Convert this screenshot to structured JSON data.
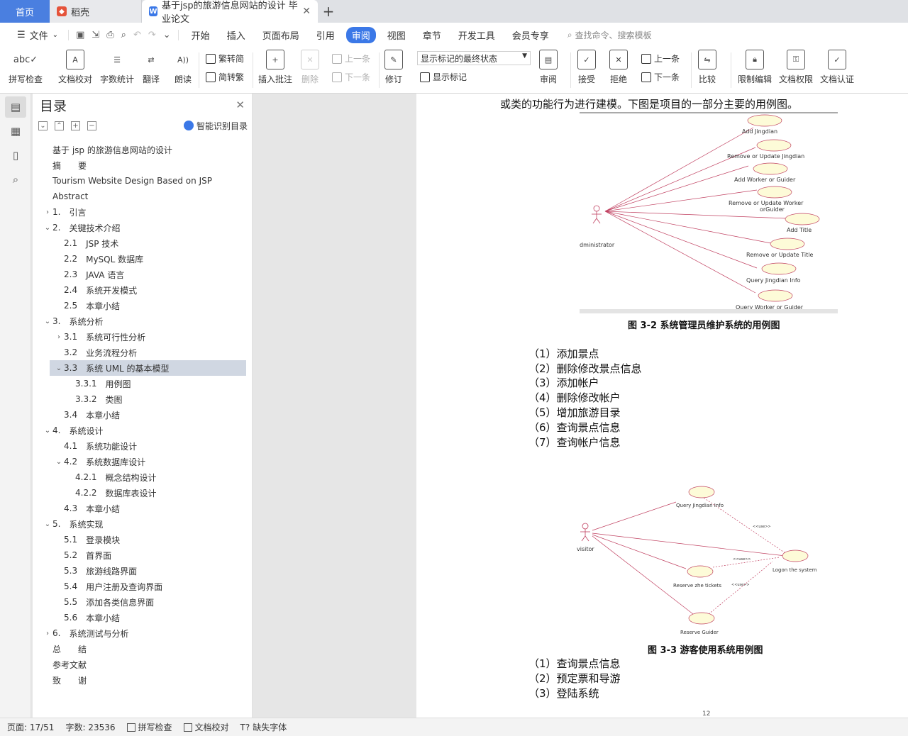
{
  "tabs": {
    "home": "首页",
    "docer": "稻壳",
    "active": "基于jsp的旅游信息网站的设计 毕业论文"
  },
  "menu": {
    "file": "文件",
    "items": [
      "开始",
      "插入",
      "页面布局",
      "引用",
      "审阅",
      "视图",
      "章节",
      "开发工具",
      "会员专享"
    ],
    "search": "查找命令、搜索模板"
  },
  "ribbon": {
    "spell": "拼写检查",
    "proof": "文档校对",
    "wordcount": "字数统计",
    "translate": "翻译",
    "read": "朗读",
    "trad": "繁转简",
    "simp": "简转繁",
    "insert_comment": "插入批注",
    "delete": "删除",
    "prev": "上一条",
    "next": "下一条",
    "revise": "修订",
    "display_state": "显示标记的最终状态",
    "show_marks": "显示标记",
    "review": "审阅",
    "accept": "接受",
    "reject": "拒绝",
    "prev2": "上一条",
    "next2": "下一条",
    "compare": "比较",
    "restrict": "限制编辑",
    "perm": "文档权限",
    "cert": "文档认证"
  },
  "toc": {
    "title": "目录",
    "smart": "智能识别目录",
    "items": [
      {
        "num": "",
        "text": "基于 jsp 的旅游信息网站的设计",
        "level": 0,
        "arrow": ""
      },
      {
        "num": "",
        "text": "摘　　要",
        "level": 0,
        "arrow": ""
      },
      {
        "num": "",
        "text": "Tourism Website Design Based on JSP",
        "level": 0,
        "arrow": ""
      },
      {
        "num": "",
        "text": "Abstract",
        "level": 0,
        "arrow": ""
      },
      {
        "num": "1.",
        "text": "引言",
        "level": 0,
        "arrow": "›"
      },
      {
        "num": "2.",
        "text": "关键技术介绍",
        "level": 0,
        "arrow": "⌄"
      },
      {
        "num": "2.1",
        "text": "JSP 技术",
        "level": 1,
        "arrow": ""
      },
      {
        "num": "2.2",
        "text": "MySQL 数据库",
        "level": 1,
        "arrow": ""
      },
      {
        "num": "2.3",
        "text": "JAVA 语言",
        "level": 1,
        "arrow": ""
      },
      {
        "num": "2.4",
        "text": "系统开发模式",
        "level": 1,
        "arrow": ""
      },
      {
        "num": "2.5",
        "text": "本章小结",
        "level": 1,
        "arrow": ""
      },
      {
        "num": "3.",
        "text": "系统分析",
        "level": 0,
        "arrow": "⌄"
      },
      {
        "num": "3.1",
        "text": "系统可行性分析",
        "level": 1,
        "arrow": "›"
      },
      {
        "num": "3.2",
        "text": "业务流程分析",
        "level": 1,
        "arrow": ""
      },
      {
        "num": "3.3",
        "text": "系统 UML 的基本模型",
        "level": 1,
        "arrow": "⌄",
        "selected": true
      },
      {
        "num": "3.3.1",
        "text": "用例图",
        "level": 2,
        "arrow": ""
      },
      {
        "num": "3.3.2",
        "text": "类图",
        "level": 2,
        "arrow": ""
      },
      {
        "num": "3.4",
        "text": "本章小结",
        "level": 1,
        "arrow": ""
      },
      {
        "num": "4.",
        "text": "系统设计",
        "level": 0,
        "arrow": "⌄"
      },
      {
        "num": "4.1",
        "text": "系统功能设计",
        "level": 1,
        "arrow": ""
      },
      {
        "num": "4.2",
        "text": "系统数据库设计",
        "level": 1,
        "arrow": "⌄"
      },
      {
        "num": "4.2.1",
        "text": "概念结构设计",
        "level": 2,
        "arrow": ""
      },
      {
        "num": "4.2.2",
        "text": "数据库表设计",
        "level": 2,
        "arrow": ""
      },
      {
        "num": "4.3",
        "text": "本章小结",
        "level": 1,
        "arrow": ""
      },
      {
        "num": "5.",
        "text": "系统实现",
        "level": 0,
        "arrow": "⌄"
      },
      {
        "num": "5.1",
        "text": "登录模块",
        "level": 1,
        "arrow": ""
      },
      {
        "num": "5.2",
        "text": "首界面",
        "level": 1,
        "arrow": ""
      },
      {
        "num": "5.3",
        "text": "旅游线路界面",
        "level": 1,
        "arrow": ""
      },
      {
        "num": "5.4",
        "text": "用户注册及查询界面",
        "level": 1,
        "arrow": ""
      },
      {
        "num": "5.5",
        "text": "添加各类信息界面",
        "level": 1,
        "arrow": ""
      },
      {
        "num": "5.6",
        "text": "本章小结",
        "level": 1,
        "arrow": ""
      },
      {
        "num": "6.",
        "text": "系统测试与分析",
        "level": 0,
        "arrow": "›"
      },
      {
        "num": "",
        "text": "总　　结",
        "level": 0,
        "arrow": ""
      },
      {
        "num": "",
        "text": "参考文献",
        "level": 0,
        "arrow": ""
      },
      {
        "num": "",
        "text": "致　　谢",
        "level": 0,
        "arrow": ""
      }
    ]
  },
  "doc": {
    "intro": "或类的功能行为进行建模。下图是项目的一部分主要的用例图。",
    "fig1": {
      "caption": "图 3-2  系统管理员维护系统的用例图",
      "actor": "dministrator",
      "cases": [
        "Add  Jingdian",
        "Remove or Update Jingdian",
        "Add Worker or Guider",
        "Remove or Update Worker",
        "orGuider",
        "Add Title",
        "Remove or Update Title",
        "Query Jingdian Info",
        "Query Worker or Guider"
      ]
    },
    "list1": [
      "（1）添加景点",
      "（2）删除修改景点信息",
      "（3）添加帐户",
      "（4）删除修改帐户",
      "（5）增加旅游目录",
      "（6）查询景点信息",
      "（7）查询帐户信息"
    ],
    "fig2": {
      "caption": "图 3-3  游客使用系统用例图",
      "actor": "visitor",
      "cases": [
        "Query Jingdian Info",
        "Reserve zhe tickets",
        "Reserve Guider",
        "Logon the system"
      ],
      "use": "<<use>>"
    },
    "list2": [
      "（1）查询景点信息",
      "（2）预定票和导游",
      "（3）登陆系统"
    ],
    "page_num": "12"
  },
  "status": {
    "page": "页面: 17/51",
    "words": "字数: 23536",
    "spell": "拼写检查",
    "proof": "文档校对",
    "font": "缺失字体"
  }
}
